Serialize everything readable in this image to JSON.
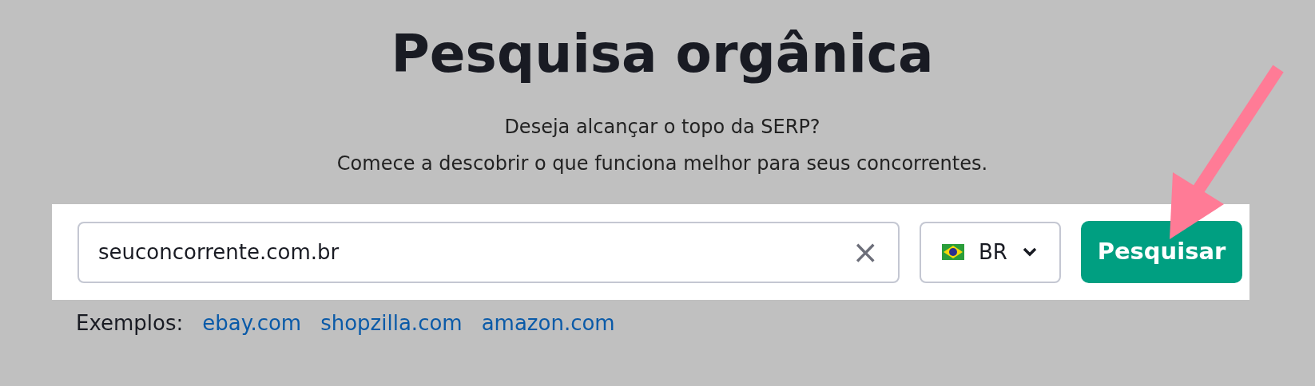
{
  "title": "Pesquisa orgânica",
  "subtitle_lines": [
    "Deseja alcançar o topo da SERP?",
    "Comece a descobrir o que funciona melhor para seus concorrentes."
  ],
  "search": {
    "value": "seuconcorrente.com.br",
    "clear_icon": "×"
  },
  "country": {
    "code": "BR"
  },
  "submit": "Pesquisar",
  "examples": {
    "label": "Exemplos:",
    "links": [
      "ebay.com",
      "shopzilla.com",
      "amazon.com"
    ]
  }
}
